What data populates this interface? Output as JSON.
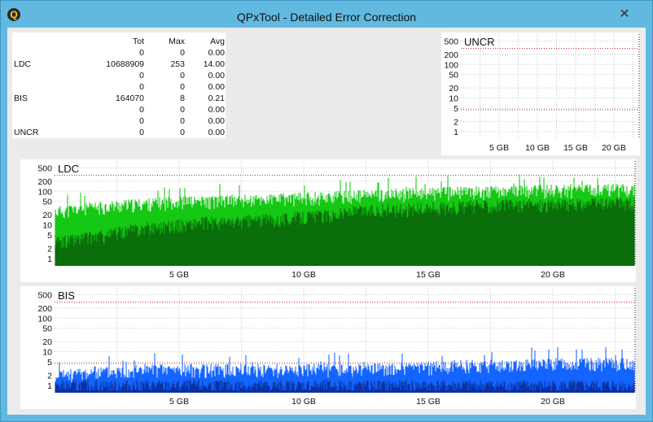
{
  "window": {
    "title": "QPxTool - Detailed Error Correction",
    "app_icon_glyph": "Q",
    "close_glyph": "✕"
  },
  "stats": {
    "headers": [
      "Tot",
      "Max",
      "Avg"
    ],
    "rows": [
      {
        "label": "",
        "tot": "0",
        "max": "0",
        "avg": "0.00"
      },
      {
        "label": "LDC",
        "tot": "10688909",
        "max": "253",
        "avg": "14.00"
      },
      {
        "label": "",
        "tot": "0",
        "max": "0",
        "avg": "0.00"
      },
      {
        "label": "",
        "tot": "0",
        "max": "0",
        "avg": "0.00"
      },
      {
        "label": "BIS",
        "tot": "164070",
        "max": "8",
        "avg": "0.21"
      },
      {
        "label": "",
        "tot": "0",
        "max": "0",
        "avg": "0.00"
      },
      {
        "label": "",
        "tot": "0",
        "max": "0",
        "avg": "0.00"
      },
      {
        "label": "UNCR",
        "tot": "0",
        "max": "0",
        "avg": "0.00"
      }
    ]
  },
  "colors": {
    "ldc_fill": "#14c814",
    "ldc_dark": "#0a6e0a",
    "bis_fill": "#1464ff",
    "bis_dark": "#0a32a0",
    "threshold": "#c02020"
  },
  "chart_data": [
    {
      "type": "area",
      "title": "UNCR",
      "y_scale": "log",
      "y_ticks": [
        "1",
        "2",
        "5",
        "10",
        "20",
        "50",
        "100",
        "200",
        "500"
      ],
      "x_ticks": [
        "5 GB",
        "10 GB",
        "15 GB",
        "20 GB"
      ],
      "xlim": [
        0,
        23.3
      ],
      "series": [
        {
          "values": []
        }
      ]
    },
    {
      "type": "area",
      "title": "LDC",
      "y_scale": "log",
      "y_ticks": [
        "1",
        "2",
        "5",
        "10",
        "20",
        "50",
        "100",
        "200",
        "500"
      ],
      "x_ticks": [
        "5 GB",
        "10 GB",
        "15 GB",
        "20 GB"
      ],
      "xlim": [
        0,
        23.3
      ],
      "x": [
        0,
        1,
        2,
        3,
        4,
        5,
        6,
        7,
        8,
        9,
        10,
        11,
        12,
        13,
        14,
        15,
        16,
        17,
        18,
        19,
        20,
        21,
        22,
        23.3
      ],
      "series": [
        {
          "values": [
            25,
            30,
            35,
            40,
            45,
            50,
            50,
            55,
            55,
            60,
            65,
            70,
            75,
            80,
            85,
            90,
            95,
            100,
            100,
            105,
            110,
            110,
            115,
            120
          ]
        },
        {
          "values": [
            3,
            4,
            5,
            7,
            9,
            10,
            12,
            12,
            14,
            15,
            18,
            20,
            25,
            28,
            30,
            32,
            35,
            38,
            40,
            40,
            42,
            42,
            45,
            45
          ]
        }
      ]
    },
    {
      "type": "area",
      "title": "BIS",
      "y_scale": "log",
      "y_ticks": [
        "1",
        "2",
        "5",
        "10",
        "20",
        "50",
        "100",
        "200",
        "500"
      ],
      "x_ticks": [
        "5 GB",
        "10 GB",
        "15 GB",
        "20 GB"
      ],
      "xlim": [
        0,
        23.3
      ],
      "x": [
        0,
        0.2,
        1.5,
        4,
        8,
        12,
        15,
        16,
        18,
        20,
        22,
        23.3
      ],
      "series": [
        {
          "values": [
            1,
            2,
            2.5,
            3,
            3,
            3,
            3.5,
            4,
            4,
            4.5,
            4.5,
            4.5
          ]
        },
        {
          "values": [
            1,
            1,
            1,
            1,
            1,
            1,
            1,
            1,
            1,
            1,
            1,
            1
          ]
        }
      ]
    }
  ]
}
